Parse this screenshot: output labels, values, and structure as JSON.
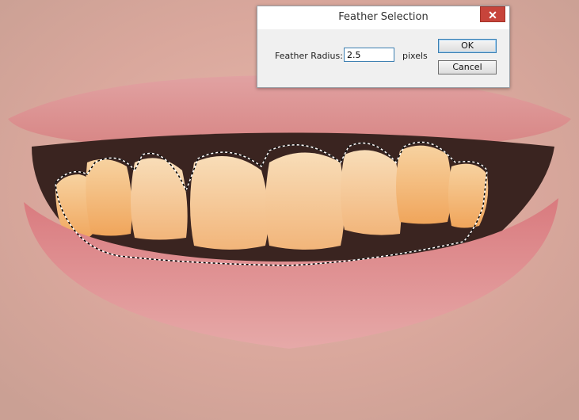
{
  "dialog": {
    "title": "Feather Selection",
    "close_glyph": "✕",
    "field_label": "Feather Radius:",
    "field_value": "2.5",
    "unit": "pixels",
    "ok_label": "OK",
    "cancel_label": "Cancel"
  },
  "colors": {
    "skin": "#d9a79c",
    "lips": "#d96f73",
    "teeth": "#f2b16a",
    "dialog_close": "#c7443b"
  }
}
